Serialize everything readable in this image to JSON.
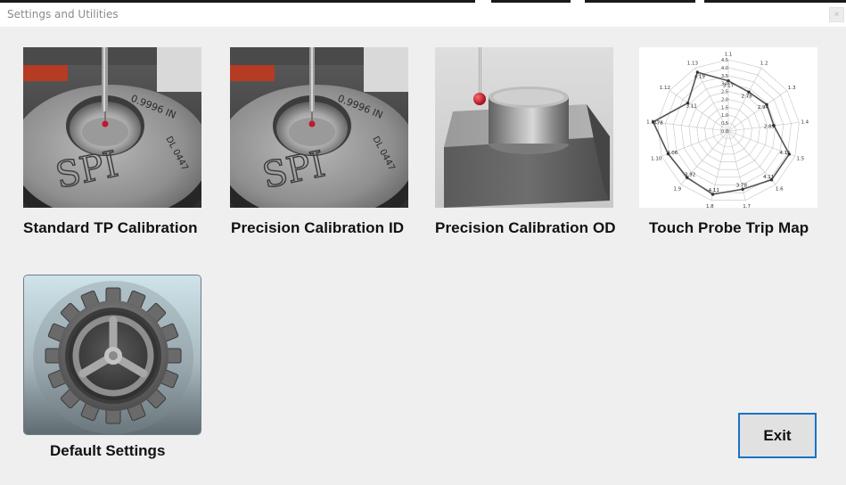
{
  "window": {
    "title": "Settings and Utilities",
    "close_glyph": "×"
  },
  "tiles": [
    {
      "label": "Standard TP Calibration",
      "icon": "ring-gauge-spi-image"
    },
    {
      "label": "Precision Calibration ID",
      "icon": "ring-gauge-probe-image"
    },
    {
      "label": "Precision Calibration OD",
      "icon": "cylinder-block-probe-image"
    },
    {
      "label": "Touch Probe Trip Map",
      "icon": "radar-chart-image"
    }
  ],
  "ring_gauge": {
    "size_text": "0.9996 IN",
    "serial_text": "DL 0447",
    "logo_text": "SPI"
  },
  "trip_map": {
    "scale_labels": [
      "4.5",
      "4.0",
      "3.5",
      "3.0",
      "2.5",
      "2.0",
      "1.5",
      "1.0",
      "0.5",
      "0.0"
    ],
    "directions": [
      "1.1",
      "1.2",
      "1.3",
      "1.4",
      "1.5",
      "1.6",
      "1.7",
      "1.8",
      "1.9",
      "1.10",
      "1.11",
      "1.12",
      "1.13"
    ],
    "values": [
      3.17,
      2.78,
      2.94,
      2.89,
      4.11,
      4.11,
      3.78,
      4.11,
      3.92,
      4.06,
      4.78,
      3.11,
      4.19
    ],
    "value_labels": [
      "3.17",
      "2.78",
      "2.94",
      "2.89",
      "4.11",
      "4.11",
      "3.78",
      "4.11",
      "3.92",
      "4.06",
      "4.78",
      "3.11",
      "4.19"
    ]
  },
  "default_settings": {
    "label": "Default Settings",
    "icon": "gear-icon"
  },
  "exit": {
    "label": "Exit"
  },
  "colors": {
    "accent": "#1a72c6",
    "probe_ruby": "#c0182c",
    "background": "#efefef"
  }
}
